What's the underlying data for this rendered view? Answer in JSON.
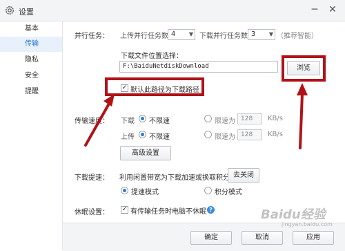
{
  "window": {
    "title": "设置",
    "minimize": "─",
    "close": "✕"
  },
  "sidebar": {
    "items": [
      {
        "label": "基本"
      },
      {
        "label": "传输"
      },
      {
        "label": "隐私"
      },
      {
        "label": "安全"
      },
      {
        "label": "提醒"
      }
    ]
  },
  "parallel": {
    "heading": "并行任务：",
    "upload_label": "上传并行任务数",
    "upload_value": "4",
    "download_label": "下载并行任务数",
    "download_value": "3",
    "hint": "（推荐智能）"
  },
  "download_location": {
    "label": "下载文件位置选择：",
    "path": "F:\\BaiduNetdiskDownload",
    "browse": "浏览",
    "default_checkbox": "默认此路径为下载路径",
    "default_checked": true
  },
  "speed": {
    "heading": "传输速度：",
    "download": {
      "label": "下载",
      "unlimited": "不限速",
      "limited": "限速为",
      "value": "128",
      "unit": "KB/s"
    },
    "upload": {
      "label": "上传",
      "unlimited": "不限速",
      "limited": "限速为",
      "value": "128",
      "unit": "KB/s"
    },
    "advanced": "高级设置"
  },
  "boost": {
    "heading": "下载提速：",
    "desc": "利用闲置带宽为下载加速或换取积分",
    "toggle_button": "去关闭",
    "mode1": "提速模式",
    "mode2": "积分模式"
  },
  "sleep": {
    "heading": "休眠设置：",
    "checkbox": "有传输任务时电脑不休眠",
    "checked": true,
    "help": "?"
  },
  "footer": {
    "ok": "确定",
    "cancel": "取消",
    "apply": "应用"
  },
  "watermark": {
    "main": "Baidu经验",
    "sub": "jingyan.baidu.com"
  },
  "colors": {
    "annotation": "#b01218",
    "accent": "#2b7bd6"
  }
}
